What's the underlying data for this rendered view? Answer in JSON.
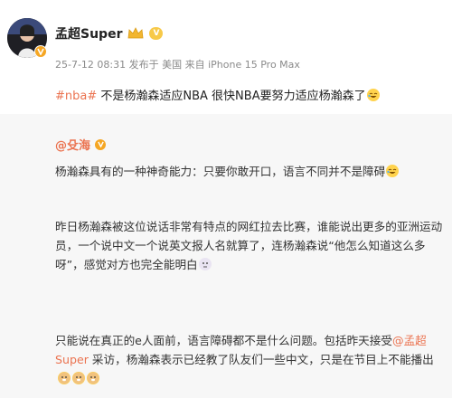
{
  "post": {
    "username": "孟超Super",
    "level": "V",
    "meta": "25-7-12 08:31  发布于 美国  来自 iPhone 15 Pro Max",
    "hashtag": "#nba#",
    "text": " 不是杨瀚森适应NBA  很快NBA要努力适应杨瀚森了",
    "emoji": "laugh-cry-emoji"
  },
  "repost": {
    "author": "@殳海",
    "para1": "杨瀚森具有的一种神奇能力：只要你敢开口，语言不同并不是障碍",
    "para2": "昨日杨瀚森被这位说话非常有特点的网红拉去比赛，谁能说出更多的亚洲运动员，一个说中文一个说英文报人名就算了，连杨瀚森说“他怎么知道这么多呀”，感觉对方也完全能明白",
    "para3_a": "只能说在真正的e人面前，语言障碍都不是什么问题。包括昨天接受",
    "para3_mention": "@孟超Super",
    "para3_b": " 采访，杨瀚森表示已经教了队友们一些中文，只是在节目上不能播出"
  },
  "colors": {
    "accent": "#eb7350",
    "verified": "#f5a623",
    "repost_bg": "#f7f7f7"
  }
}
